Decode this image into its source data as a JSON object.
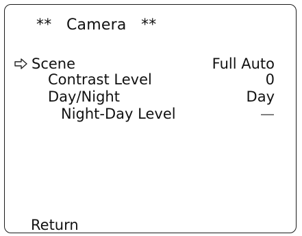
{
  "menu": {
    "title": "**   Camera   **",
    "cursor_icon": "right-arrow-outline-icon",
    "items": [
      {
        "label": "Scene",
        "value": "Full Auto",
        "selected": true
      },
      {
        "label": "Contrast Level",
        "value": "0",
        "selected": false
      },
      {
        "label": "Day/Night",
        "value": "Day",
        "selected": false
      },
      {
        "label": "Night-Day Level",
        "value": "—",
        "selected": false
      }
    ],
    "return_label": "Return"
  }
}
